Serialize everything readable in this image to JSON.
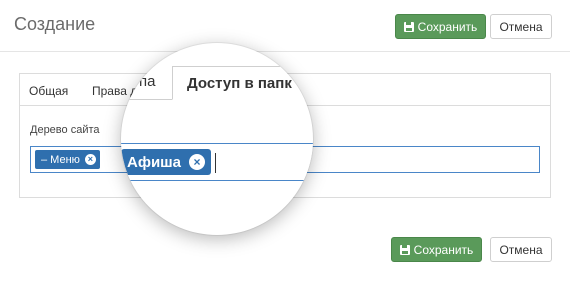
{
  "header": {
    "title": "Создание",
    "save_label": "Сохранить",
    "cancel_label": "Отмена"
  },
  "tabs": [
    {
      "label": "Общая"
    },
    {
      "label": "Права д"
    }
  ],
  "field": {
    "label": "Дерево сайта",
    "tags": [
      {
        "label": "– Меню",
        "remove_icon": "×"
      }
    ]
  },
  "magnifier": {
    "prev_tab": "па",
    "active_tab": "Доступ в папк",
    "tag": {
      "label": "Афиша",
      "remove_icon": "×"
    }
  },
  "footer": {
    "save_label": "Сохранить",
    "cancel_label": "Отмена"
  },
  "colors": {
    "save": "#5a9a5a",
    "tag": "#2f6fae",
    "focus_border": "#4a86c8"
  }
}
